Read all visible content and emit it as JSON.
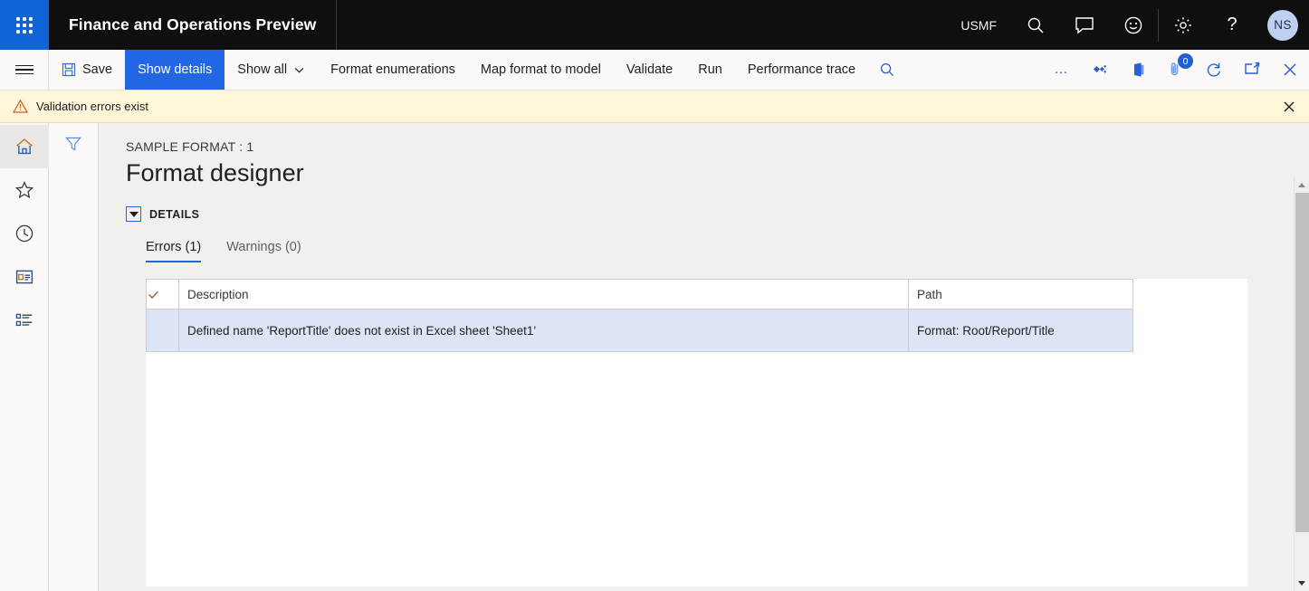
{
  "topbar": {
    "waffle_icon": "app-launcher-icon",
    "title": "Finance and Operations Preview",
    "company": "USMF",
    "icons": [
      {
        "name": "search-icon",
        "label": "Search"
      },
      {
        "name": "feedback-chat-icon",
        "label": "Feedback"
      },
      {
        "name": "smiley-icon",
        "label": "Smiley"
      },
      {
        "name": "gear-icon",
        "label": "Settings"
      },
      {
        "name": "help-icon",
        "label": "Help"
      }
    ],
    "avatar_initials": "NS"
  },
  "commandbar": {
    "hamburger_label": "Navigation menu",
    "save_label": "Save",
    "show_details_label": "Show details",
    "show_all_label": "Show all",
    "format_enumerations_label": "Format enumerations",
    "map_format_label": "Map format to model",
    "validate_label": "Validate",
    "run_label": "Run",
    "performance_trace_label": "Performance trace",
    "search_icon": "search-icon",
    "overflow_label": "…",
    "icons": [
      {
        "name": "share-icon"
      },
      {
        "name": "open-in-office-icon"
      },
      {
        "name": "attachments-icon",
        "badge": "0"
      },
      {
        "name": "refresh-icon"
      },
      {
        "name": "open-in-new-window-icon"
      },
      {
        "name": "close-icon"
      }
    ],
    "attachment_badge": "0"
  },
  "messagebar": {
    "icon": "warning-triangle-icon",
    "text": "Validation errors exist",
    "close_icon": "close-icon"
  },
  "navrail": {
    "items": [
      {
        "name": "sidebar-item-home",
        "icon": "home-icon",
        "selected": true
      },
      {
        "name": "sidebar-item-favorites",
        "icon": "star-icon",
        "selected": false
      },
      {
        "name": "sidebar-item-recent",
        "icon": "clock-icon",
        "selected": false
      },
      {
        "name": "sidebar-item-workspaces",
        "icon": "workspace-icon",
        "selected": false
      },
      {
        "name": "sidebar-item-modules",
        "icon": "modules-list-icon",
        "selected": false
      }
    ]
  },
  "filterpane": {
    "filter_icon": "filter-funnel-icon"
  },
  "main": {
    "breadcrumb": "SAMPLE FORMAT : 1",
    "page_title": "Format designer",
    "section_label": "DETAILS",
    "tabs": [
      {
        "label": "Errors (1)",
        "active": true
      },
      {
        "label": "Warnings (0)",
        "active": false
      }
    ],
    "grid": {
      "columns": [
        "",
        "Description",
        "Path"
      ],
      "select_all_icon": "checkmark-icon",
      "rows": [
        {
          "description": "Defined name 'ReportTitle' does not exist in Excel sheet 'Sheet1'",
          "path": "Format: Root/Report/Title",
          "selected": true
        }
      ]
    }
  },
  "scrollbar": {
    "up_arrow": "scroll-up-icon",
    "down_arrow": "scroll-down-icon"
  },
  "colors": {
    "accent_blue": "#2266e3",
    "brand_blue": "#1164d6",
    "topbar_black": "#0f0f0f",
    "warning_bg": "#fdf6d9",
    "row_selected": "#dbe5f6",
    "content_bg": "#f1f0ef"
  }
}
